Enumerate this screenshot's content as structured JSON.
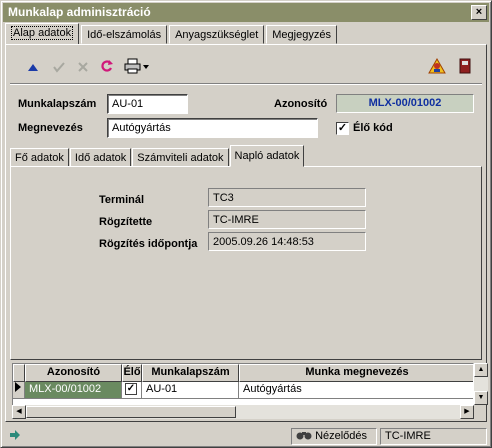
{
  "window": {
    "title": "Munkalap adminisztráció",
    "close_glyph": "×"
  },
  "tabs": [
    "Alap adatok",
    "Idő-elszámolás",
    "Anyagszükséglet",
    "Megjegyzés"
  ],
  "toolbar": {
    "icons": [
      "arrow-up-icon",
      "check-icon",
      "cancel-x-icon",
      "refresh-icon",
      "printer-icon",
      "user-warning-icon",
      "exit-door-icon"
    ]
  },
  "form": {
    "munkalapszam_label": "Munkalapszám",
    "munkalapszam_value": "AU-01",
    "azonosito_label": "Azonosító",
    "azonosito_value": "MLX-00/01002",
    "megnevezes_label": "Megnevezés",
    "megnevezes_value": "Autógyártás",
    "elo_kod_label": "Élő kód",
    "elo_kod_checked": true
  },
  "subtabs": [
    "Fő adatok",
    "Idő adatok",
    "Számviteli adatok",
    "Napló adatok"
  ],
  "naplo": {
    "terminal_label": "Terminál",
    "terminal_value": "TC3",
    "rogzitette_label": "Rögzítette",
    "rogzitette_value": "TC-IMRE",
    "rogzites_idopontja_label": "Rögzítés időpontja",
    "rogzites_idopontja_value": "2005.09.26 14:48:53"
  },
  "grid": {
    "columns": [
      "Azonosító",
      "Élő",
      "Munkalapszám",
      "Munka megnevezés"
    ],
    "rows": [
      {
        "azonosito": "MLX-00/01002",
        "elo": true,
        "munkalapszam": "AU-01",
        "megnevezes": "Autógyártás"
      }
    ]
  },
  "status": {
    "mode": "Nézelődés",
    "user": "TC-IMRE"
  },
  "colors": {
    "titlebar": "#8a8e69",
    "azonosito_text": "#1030a0",
    "selected_cell": "#6a8a60"
  }
}
